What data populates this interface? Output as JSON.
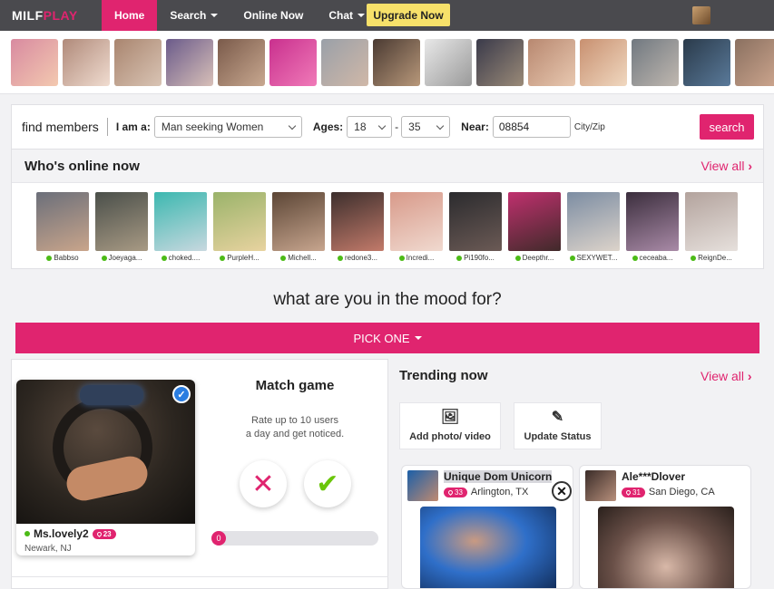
{
  "nav": {
    "logo_a": "MILF",
    "logo_b": "PLAY",
    "home": "Home",
    "search": "Search",
    "online_now": "Online Now",
    "chat": "Chat",
    "upgrade": "Upgrade Now",
    "accent": "#e0246f"
  },
  "search": {
    "find_label": "find members",
    "i_am_label": "I am a:",
    "seeking_value": "Man seeking Women",
    "ages_label": "Ages:",
    "age_min": "18",
    "age_dash": "-",
    "age_max": "35",
    "near_label": "Near:",
    "near_value": "08854",
    "cityzip": "City/Zip",
    "button": "search"
  },
  "online": {
    "title": "Who's online now",
    "view_all": "View all",
    "people": [
      {
        "name": "Babbso",
        "c1": "#6b6f7a",
        "c2": "#c9a58b"
      },
      {
        "name": "Joeyaga...",
        "c1": "#4a4f4a",
        "c2": "#a89a84"
      },
      {
        "name": "choked....",
        "c1": "#3cb8b0",
        "c2": "#c8d8df"
      },
      {
        "name": "PurpleH...",
        "c1": "#9ab36a",
        "c2": "#e8d3a0"
      },
      {
        "name": "Michell...",
        "c1": "#5c4636",
        "c2": "#c7a58e"
      },
      {
        "name": "redone3...",
        "c1": "#3d2f2d",
        "c2": "#c27a6a"
      },
      {
        "name": "Incredi...",
        "c1": "#d89a8a",
        "c2": "#f0d9cf"
      },
      {
        "name": "Pi190fo...",
        "c1": "#2b2b2e",
        "c2": "#6b5a55"
      },
      {
        "name": "Deepthr...",
        "c1": "#c0306e",
        "c2": "#402a2a"
      },
      {
        "name": "SEXYWET...",
        "c1": "#7c8da3",
        "c2": "#dcd3ca"
      },
      {
        "name": "ceceaba...",
        "c1": "#3b2e3d",
        "c2": "#a98aa7"
      },
      {
        "name": "ReignDe...",
        "c1": "#b3a39d",
        "c2": "#e6e0dc"
      }
    ]
  },
  "strip_colors": [
    [
      "#d88aa0",
      "#f3c9b0"
    ],
    [
      "#b08a7a",
      "#f0dcd0"
    ],
    [
      "#a9856f",
      "#d9c4b4"
    ],
    [
      "#6a5a8a",
      "#d8c0b8"
    ],
    [
      "#7a5a4a",
      "#c8a890"
    ],
    [
      "#c9308e",
      "#f07ab8"
    ],
    [
      "#9aa0a8",
      "#d0b8a8"
    ],
    [
      "#4a3a32",
      "#b8987a"
    ],
    [
      "#e8e8e8",
      "#9a9a9a"
    ],
    [
      "#3a3a4a",
      "#9a8a78"
    ],
    [
      "#b88870",
      "#e8c8b0"
    ],
    [
      "#c89070",
      "#f0d8c0"
    ],
    [
      "#707880",
      "#c0b8b0"
    ],
    [
      "#2a3a4a",
      "#5a7a9a"
    ],
    [
      "#8a7060",
      "#d0a890"
    ]
  ],
  "mood": {
    "question": "what are you in the mood for?",
    "pick": "PICK ONE"
  },
  "match": {
    "title": "Match game",
    "desc1": "Rate up to 10 users",
    "desc2": "a day and get noticed.",
    "profile_name": "Ms.lovely2",
    "profile_age": "23",
    "profile_loc": "Newark, NJ",
    "progress_value": "0",
    "no_icon": "close-icon",
    "yes_icon": "check-icon"
  },
  "trending": {
    "title": "Trending now",
    "view_all": "View all",
    "add_photo": "Add photo/ video",
    "update_status": "Update Status",
    "cards": [
      {
        "name": "Unique Dom Unicorn",
        "age": "33",
        "loc": "Arlington, TX"
      },
      {
        "name": "Ale***Dlover",
        "age": "31",
        "loc": "San Diego, CA"
      }
    ]
  }
}
